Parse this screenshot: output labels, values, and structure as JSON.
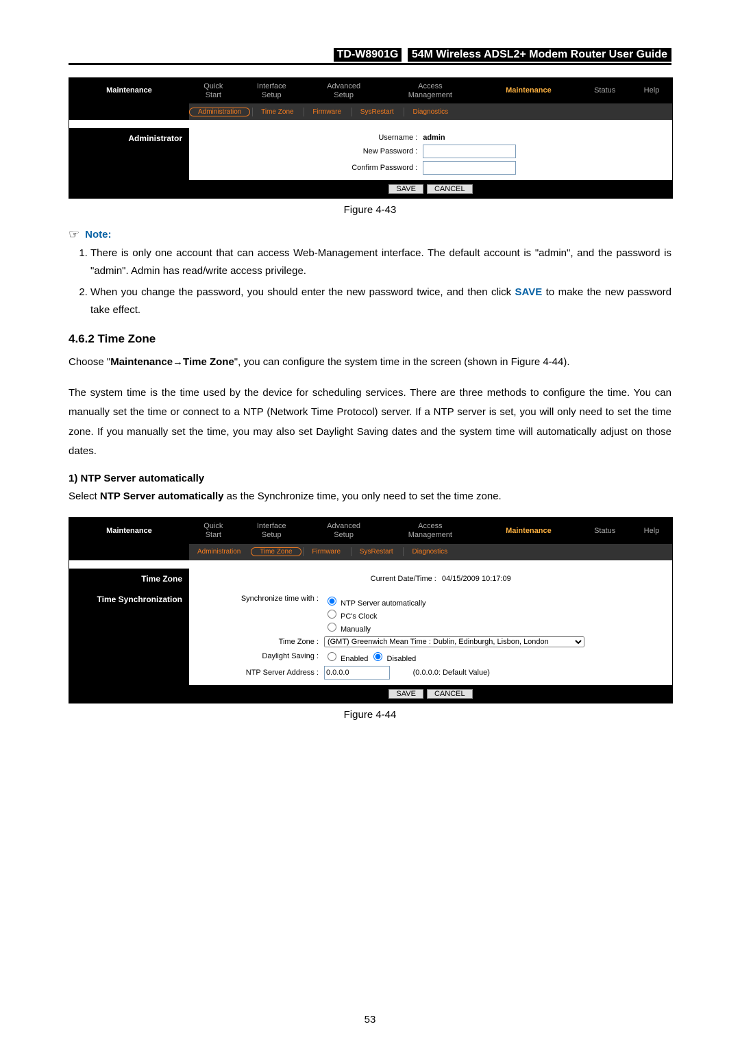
{
  "header": {
    "model": "TD-W8901G",
    "title": "54M Wireless ADSL2+ Modem Router User Guide"
  },
  "fig43": {
    "caption": "Figure 4-43",
    "side_title": "Maintenance",
    "nav": [
      "Quick Start",
      "Interface Setup",
      "Advanced Setup",
      "Access Management",
      "Maintenance",
      "Status",
      "Help"
    ],
    "nav_active": "Maintenance",
    "subnav": [
      "Administration",
      "Time Zone",
      "Firmware",
      "SysRestart",
      "Diagnostics"
    ],
    "subnav_sel": "Administration",
    "side_section": "Administrator",
    "labels": {
      "username": "Username :",
      "username_value": "admin",
      "newpwd": "New Password :",
      "confpwd": "Confirm Password :"
    },
    "buttons": {
      "save": "SAVE",
      "cancel": "CANCEL"
    }
  },
  "note": {
    "icon": "☞",
    "label": "Note:",
    "items": [
      "There is only one account that can access Web-Management interface. The default account is \"admin\", and the password is \"admin\". Admin has read/write access privilege.",
      "When you change the password, you should enter the new password twice, and then click SAVE to make the new password take effect."
    ],
    "save_kw": "SAVE"
  },
  "sec": {
    "heading": "4.6.2  Time Zone",
    "para1_a": "Choose \"",
    "para1_b": "Maintenance→Time Zone",
    "para1_c": "\", you can configure the system time in the screen (shown in Figure 4-44).",
    "para2": "The system time is the time used by the device for scheduling services. There are three methods to configure the time. You can manually set the time or connect to a NTP (Network Time Protocol) server. If a NTP server is set, you will only need to set the time zone. If you manually set the time, you may also set Daylight Saving dates and the system time will automatically adjust on those dates.",
    "sub1_head": "1)   NTP Server automatically",
    "sub1_line_a": "Select ",
    "sub1_line_b": "NTP Server automatically",
    "sub1_line_c": " as the Synchronize time, you only need to set the time zone."
  },
  "fig44": {
    "caption": "Figure 4-44",
    "side_title": "Maintenance",
    "nav": [
      "Quick Start",
      "Interface Setup",
      "Advanced Setup",
      "Access Management",
      "Maintenance",
      "Status",
      "Help"
    ],
    "nav_active": "Maintenance",
    "subnav": [
      "Administration",
      "Time Zone",
      "Firmware",
      "SysRestart",
      "Diagnostics"
    ],
    "subnav_sel": "Time Zone",
    "side_section1": "Time Zone",
    "side_section2": "Time Synchronization",
    "labels": {
      "curdate": "Current Date/Time :",
      "curdate_val": "04/15/2009 10:17:09",
      "sync": "Synchronize time with :",
      "opt_ntp": "NTP Server automatically",
      "opt_pc": "PC's Clock",
      "opt_man": "Manually",
      "tz": "Time Zone :",
      "tz_val": "(GMT) Greenwich Mean Time : Dublin, Edinburgh, Lisbon, London",
      "dst": "Daylight Saving :",
      "dst_en": "Enabled",
      "dst_dis": "Disabled",
      "ntp": "NTP Server Address :",
      "ntp_val": "0.0.0.0",
      "ntp_hint": "(0.0.0.0: Default Value)"
    },
    "buttons": {
      "save": "SAVE",
      "cancel": "CANCEL"
    }
  },
  "pagenum": "53"
}
